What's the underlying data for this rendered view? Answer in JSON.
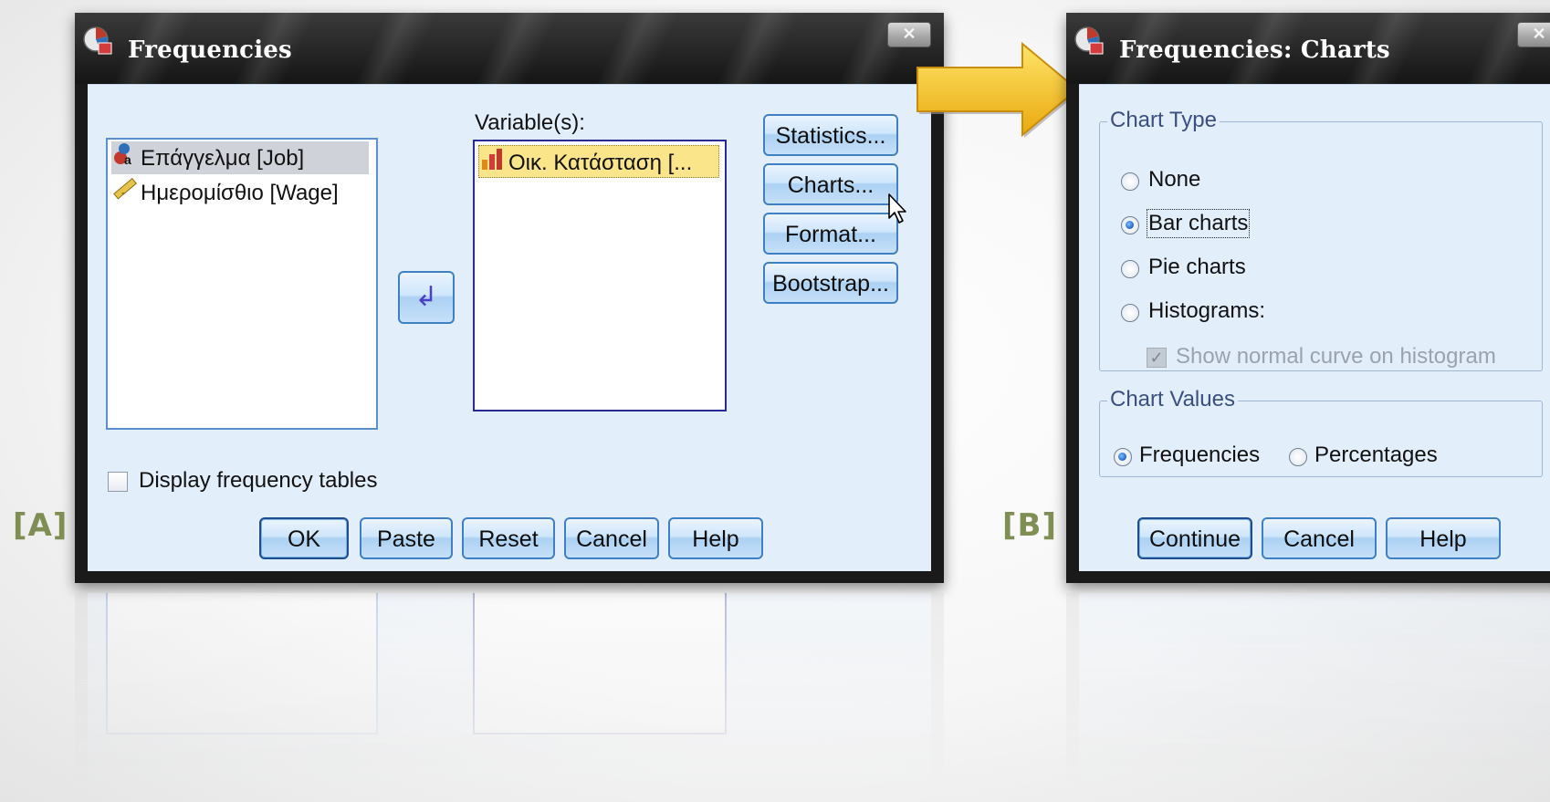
{
  "dialog_a": {
    "title": "Frequencies",
    "close_glyph": "✕",
    "source_list": [
      {
        "icon": "nominal-variable-icon",
        "label": "Επάγγελμα [Job]"
      },
      {
        "icon": "scale-ruler-icon",
        "label": "Ημερομίσθιο [Wage]"
      }
    ],
    "move_arrow_glyph": "↲",
    "variables_label": "Variable(s):",
    "variables_list": [
      {
        "icon": "bar-chart-variable-icon",
        "label": "Οικ. Κατάσταση [..."
      }
    ],
    "side_buttons": {
      "statistics": "Statistics...",
      "charts": "Charts...",
      "format": "Format...",
      "bootstrap": "Bootstrap..."
    },
    "display_frequency_tables": {
      "label": "Display frequency tables",
      "checked": false
    },
    "buttons": {
      "ok": "OK",
      "paste": "Paste",
      "reset": "Reset",
      "cancel": "Cancel",
      "help": "Help"
    },
    "tag": "[A]"
  },
  "dialog_b": {
    "title": "Frequencies: Charts",
    "close_glyph": "✕",
    "chart_type": {
      "legend": "Chart Type",
      "options": {
        "none": "None",
        "bar": "Bar charts",
        "pie": "Pie charts",
        "histograms": "Histograms:"
      },
      "selected": "Bar charts",
      "normal_curve": {
        "label": "Show normal curve on histogram",
        "checked": true,
        "enabled": false
      }
    },
    "chart_values": {
      "legend": "Chart Values",
      "options": {
        "frequencies": "Frequencies",
        "percentages": "Percentages"
      },
      "selected": "Frequencies"
    },
    "buttons": {
      "continue": "Continue",
      "cancel": "Cancel",
      "help": "Help"
    },
    "tag": "[B]"
  },
  "colors": {
    "client_bg": "#e3eefb",
    "button_border": "#3f80c4",
    "arrow": "#f3c21b",
    "tag_color": "#7f8f53"
  }
}
